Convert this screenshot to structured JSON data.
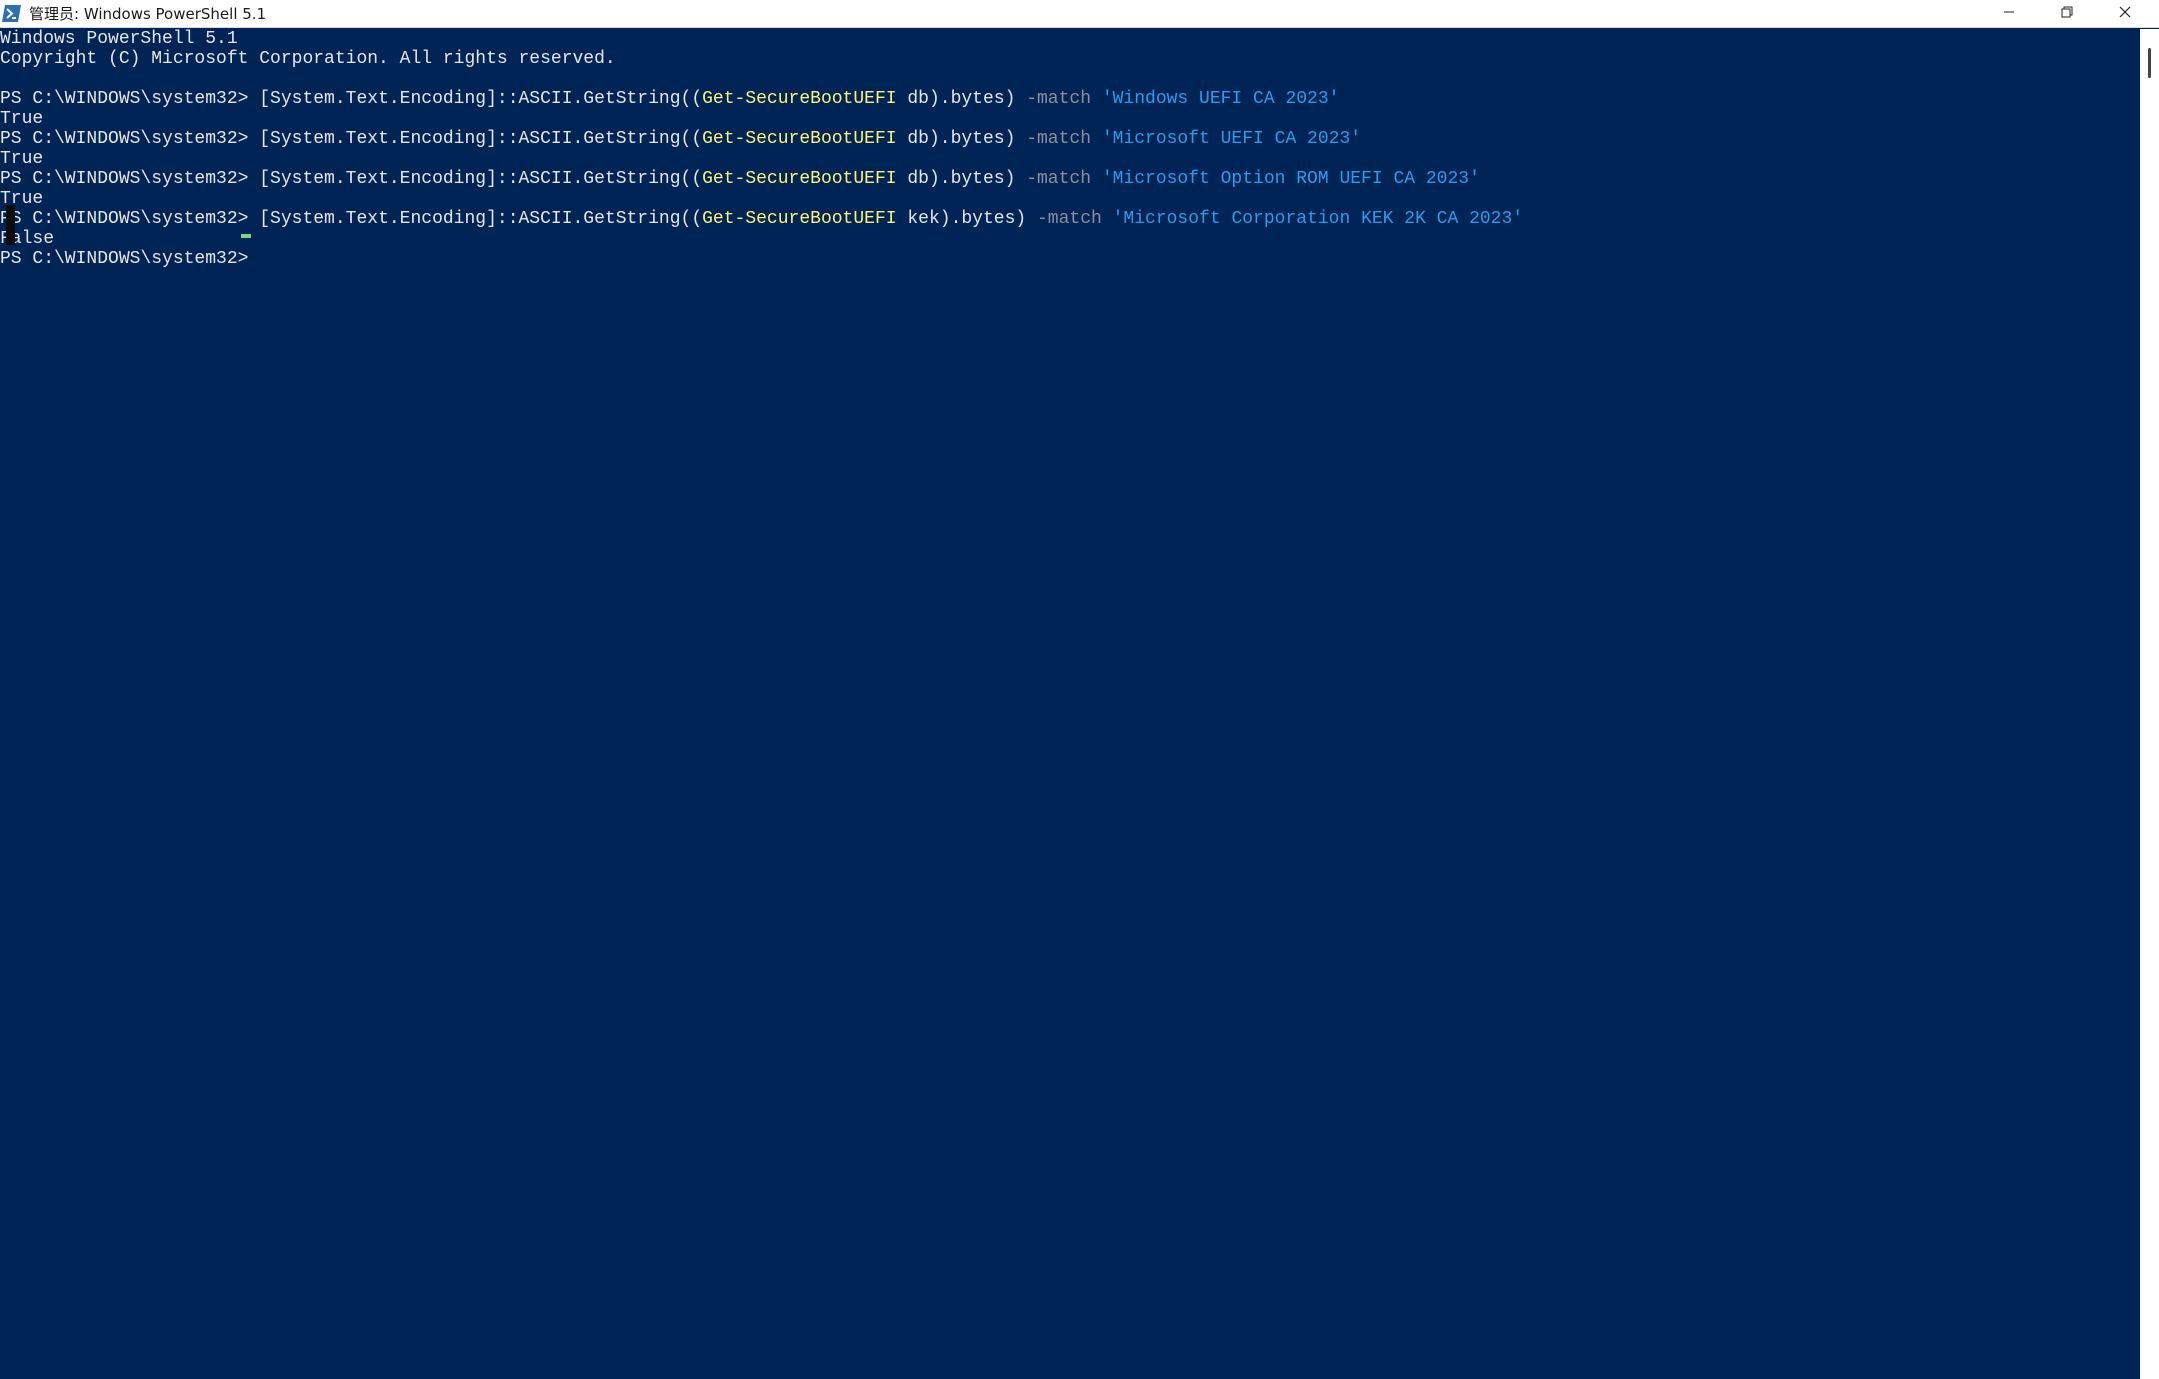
{
  "window": {
    "title": "管理员: Windows PowerShell 5.1",
    "icons": {
      "app": "powershell-icon",
      "minimize": "minimize-icon",
      "maximize": "restore-icon",
      "close": "close-icon"
    }
  },
  "console": {
    "lines": [
      {
        "segments": [
          {
            "text": "Windows PowerShell 5.1",
            "style": "txt"
          }
        ]
      },
      {
        "segments": [
          {
            "text": "Copyright (C) Microsoft Corporation. All rights reserved.",
            "style": "txt"
          }
        ]
      },
      {
        "segments": []
      },
      {
        "segments": [
          {
            "text": "PS C:\\WINDOWS\\system32> ",
            "style": "txt"
          },
          {
            "text": "[System.Text.Encoding]::ASCII.GetString((",
            "style": "txt"
          },
          {
            "text": "Get-SecureBootUEFI",
            "style": "cmd"
          },
          {
            "text": " db).bytes) ",
            "style": "txt"
          },
          {
            "text": "-match",
            "style": "op"
          },
          {
            "text": " ",
            "style": "txt"
          },
          {
            "text": "'Windows UEFI CA 2023'",
            "style": "str"
          }
        ]
      },
      {
        "segments": [
          {
            "text": "True",
            "style": "txt"
          }
        ]
      },
      {
        "segments": [
          {
            "text": "PS C:\\WINDOWS\\system32> ",
            "style": "txt"
          },
          {
            "text": "[System.Text.Encoding]::ASCII.GetString((",
            "style": "txt"
          },
          {
            "text": "Get-SecureBootUEFI",
            "style": "cmd"
          },
          {
            "text": " db).bytes) ",
            "style": "txt"
          },
          {
            "text": "-match",
            "style": "op"
          },
          {
            "text": " ",
            "style": "txt"
          },
          {
            "text": "'Microsoft UEFI CA 2023'",
            "style": "str"
          }
        ]
      },
      {
        "segments": [
          {
            "text": "True",
            "style": "txt"
          }
        ]
      },
      {
        "segments": [
          {
            "text": "PS C:\\WINDOWS\\system32> ",
            "style": "txt"
          },
          {
            "text": "[System.Text.Encoding]::ASCII.GetString((",
            "style": "txt"
          },
          {
            "text": "Get-SecureBootUEFI",
            "style": "cmd"
          },
          {
            "text": " db).bytes) ",
            "style": "txt"
          },
          {
            "text": "-match",
            "style": "op"
          },
          {
            "text": " ",
            "style": "txt"
          },
          {
            "text": "'Microsoft Option ROM UEFI CA 2023'",
            "style": "str"
          }
        ]
      },
      {
        "segments": [
          {
            "text": "True",
            "style": "txt"
          }
        ]
      },
      {
        "segments": [
          {
            "text": "PS C:\\WINDOWS\\system32> ",
            "style": "txt"
          },
          {
            "text": "[System.Text.Encoding]::ASCII.GetString((",
            "style": "txt"
          },
          {
            "text": "Get-SecureBootUEFI",
            "style": "cmd"
          },
          {
            "text": " kek).bytes) ",
            "style": "txt"
          },
          {
            "text": "-match",
            "style": "op"
          },
          {
            "text": " ",
            "style": "txt"
          },
          {
            "text": "'Microsoft Corporation KEK 2K CA 2023'",
            "style": "str"
          }
        ]
      },
      {
        "segments": [
          {
            "text": "False",
            "style": "txt"
          }
        ]
      },
      {
        "segments": [
          {
            "text": "PS C:\\WINDOWS\\system32> ",
            "style": "txt"
          }
        ]
      }
    ]
  },
  "colors": {
    "background": "#012456",
    "text": "#e6e6e6",
    "command": "#fff176",
    "operator": "#8a8f99",
    "string": "#2b9bea",
    "cursor": "#7fd37f"
  }
}
